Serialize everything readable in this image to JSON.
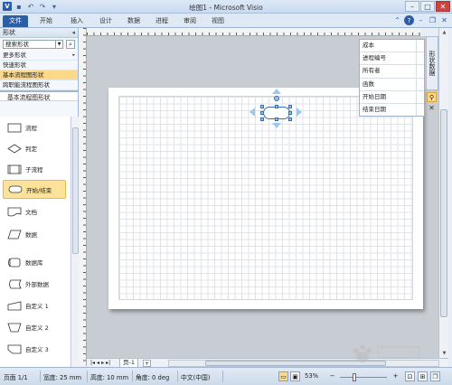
{
  "window": {
    "title": "绘图1 - Microsoft Visio"
  },
  "ribbon": {
    "tabs": [
      {
        "label": "文件"
      },
      {
        "label": "开始"
      },
      {
        "label": "插入"
      },
      {
        "label": "设计"
      },
      {
        "label": "数据"
      },
      {
        "label": "进程"
      },
      {
        "label": "审阅"
      },
      {
        "label": "视图"
      }
    ]
  },
  "shapes_pane": {
    "title": "形状",
    "search_placeholder": "搜索形状",
    "menu": [
      {
        "label": "更多形状",
        "arrow": "▸"
      },
      {
        "label": "快速形状"
      },
      {
        "label": "基本流程图形状",
        "active": true
      },
      {
        "label": "跨职能流程图形状"
      }
    ],
    "stencil_title": "基本流程图形状",
    "shapes": [
      {
        "label": "流程",
        "icon": "process-icon"
      },
      {
        "label": "判定",
        "icon": "decision-icon"
      },
      {
        "label": "子流程",
        "icon": "subprocess-icon"
      },
      {
        "label": "开始/结束",
        "icon": "terminator-icon",
        "selected": true
      },
      {
        "label": "文档",
        "icon": "document-icon"
      },
      {
        "label": "数据",
        "icon": "data-icon"
      },
      {
        "label": "数据库",
        "icon": "database-icon"
      },
      {
        "label": "外部数据",
        "icon": "external-data-icon"
      },
      {
        "label": "自定义 1",
        "icon": "custom1-icon"
      },
      {
        "label": "自定义 2",
        "icon": "custom2-icon"
      },
      {
        "label": "自定义 3",
        "icon": "custom3-icon"
      }
    ]
  },
  "shape_data": {
    "rows": [
      {
        "label": "成本"
      },
      {
        "label": "进程编号"
      },
      {
        "label": "所有者"
      },
      {
        "label": "函数"
      },
      {
        "label": "开始日期"
      },
      {
        "label": "结束日期"
      }
    ],
    "pane_tab": "形状数据"
  },
  "page_nav": {
    "page_tab": "页-1"
  },
  "status": {
    "page": "页面 1/1",
    "width": "宽度: 25 mm",
    "height": "高度: 10 mm",
    "angle": "角度: 0 deg",
    "language": "中文(中国)",
    "zoom": "53%"
  },
  "colors": {
    "accent": "#2a5ea8",
    "highlight": "#fbd88a"
  }
}
